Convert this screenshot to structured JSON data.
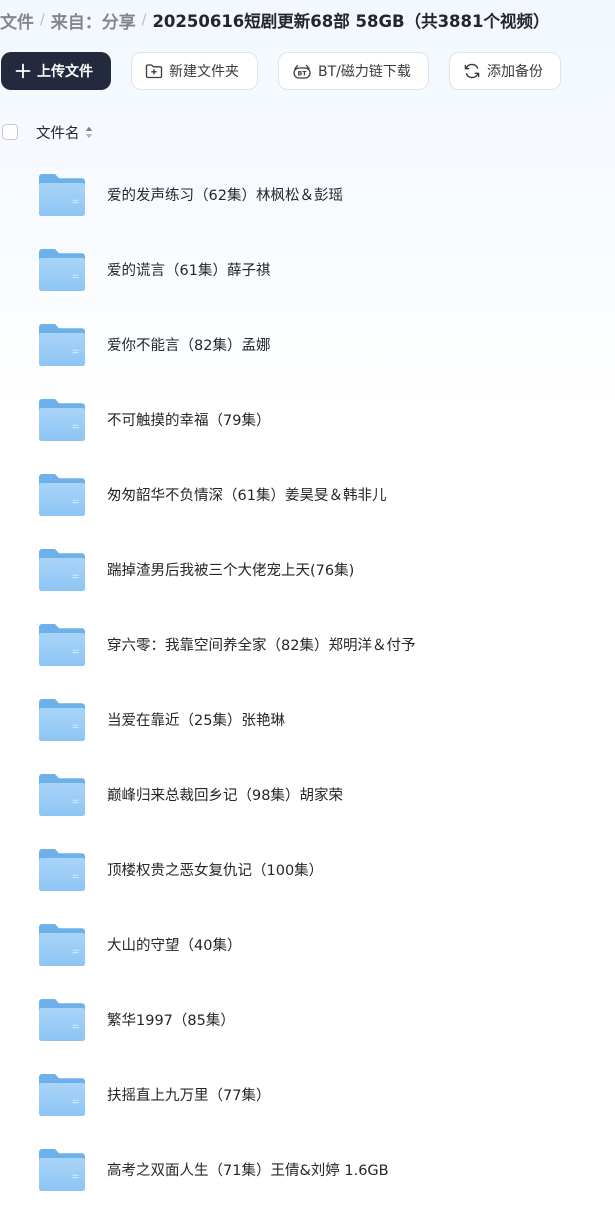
{
  "breadcrumb": {
    "items": [
      "文件",
      "来自：分享"
    ],
    "separator": "/",
    "current": "20250616短剧更新68部 58GB（共3881个视频）"
  },
  "toolbar": {
    "upload_label": "上传文件",
    "new_folder_label": "新建文件夹",
    "bt_label": "BT/磁力链下载",
    "backup_label": "添加备份"
  },
  "list_header": {
    "name_column": "文件名"
  },
  "files": [
    {
      "name": "爱的发声练习（62集）林枫松＆彭瑶"
    },
    {
      "name": "爱的谎言（61集）薛子祺"
    },
    {
      "name": "爱你不能言（82集）孟娜"
    },
    {
      "name": "不可触摸的幸福（79集）"
    },
    {
      "name": "匆匆韶华不负情深（61集）姜昊旻＆韩非儿"
    },
    {
      "name": "踹掉渣男后我被三个大佬宠上天(76集)"
    },
    {
      "name": "穿六零：我靠空间养全家（82集）郑明洋＆付予"
    },
    {
      "name": "当爱在靠近（25集）张艳琳"
    },
    {
      "name": "巅峰归来总裁回乡记（98集）胡家荣"
    },
    {
      "name": "顶楼权贵之恶女复仇记（100集）"
    },
    {
      "name": "大山的守望（40集）"
    },
    {
      "name": "繁华1997（85集）"
    },
    {
      "name": "扶摇直上九万里（77集）"
    },
    {
      "name": "高考之双面人生（71集）王倩&刘婷 1.6GB"
    }
  ],
  "icons": {
    "folder": "folder-icon",
    "upload": "plus-icon",
    "new_folder": "folder-plus-icon",
    "bt": "bt-icon",
    "backup": "sync-icon",
    "sort": "sort-icon"
  },
  "colors": {
    "primary_button": "#232a3d",
    "folder_light": "#a6d2f7",
    "folder_dark": "#6cb1ea",
    "text": "#25262b",
    "muted": "#84868d"
  }
}
